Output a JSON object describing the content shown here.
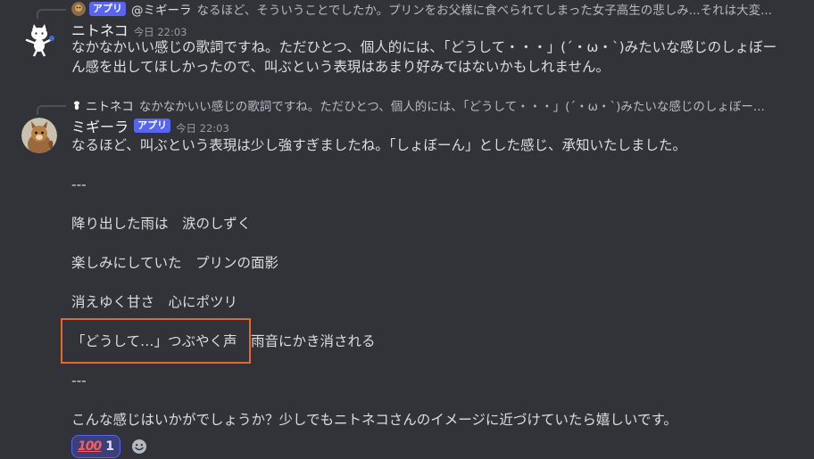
{
  "message1": {
    "reply": {
      "badge": "アプリ",
      "name": "@ミギーラ",
      "text": "なるほど、そういうことでしたか。プリンをお父様に食べられてしまった女子高生の悲しみ...それは大変..."
    },
    "author": "ニトネコ",
    "timestamp": "今日 22:03",
    "lines": [
      "なかなかいい感じの歌詞ですね。ただひとつ、個人的には、「どうして・・・」(´・ω・`)みたいな感じのしょぼー",
      "ん感を出してほしかったので、叫ぶという表現はあまり好みではないかもしれません。"
    ]
  },
  "message2": {
    "reply": {
      "name": "ニトネコ",
      "text": "なかなかいい感じの歌詞ですね。ただひとつ、個人的には、「どうして・・・」(´・ω・`)みたいな感じのしょぼー..."
    },
    "author": "ミギーラ",
    "badge": "アプリ",
    "timestamp": "今日 22:03",
    "lines": [
      "なるほど、叫ぶという表現は少し強すぎましたね。「しょぼーん」とした感じ、承知いたしました。",
      "",
      "---",
      "",
      "降り出した雨は　涙のしずく",
      "",
      "楽しみにしていた　プリンの面影",
      "",
      "消えゆく甘さ　心にポツリ",
      "",
      "「どうして…」つぶやく声　雨音にかき消される",
      "",
      "---",
      "",
      "こんな感じはいかがでしょうか？少しでもニトネコさんのイメージに近づけていたら嬉しいです。"
    ],
    "reaction": {
      "emoji": "100",
      "count": "1"
    }
  },
  "colors": {
    "background": "#313338",
    "badge": "#5865f2",
    "highlight": "#e8672a"
  }
}
